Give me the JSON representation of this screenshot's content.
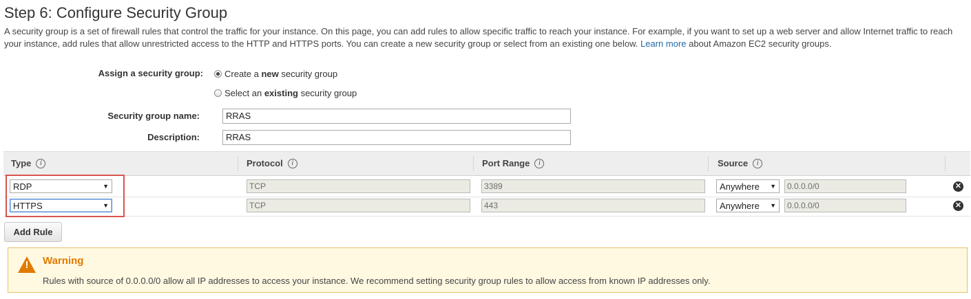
{
  "page": {
    "title": "Step 6: Configure Security Group",
    "intro_before_link": "A security group is a set of firewall rules that control the traffic for your instance. On this page, you can add rules to allow specific traffic to reach your instance. For example, if you want to set up a web server and allow Internet traffic to reach your instance, add rules that allow unrestricted access to the HTTP and HTTPS ports. You can create a new security group or select from an existing one below.",
    "intro_link": "Learn more",
    "intro_after_link": "about Amazon EC2 security groups."
  },
  "assign": {
    "label": "Assign a security group:",
    "options": [
      {
        "pre": "Create a ",
        "bold": "new",
        "post": " security group",
        "selected": true
      },
      {
        "pre": "Select an ",
        "bold": "existing",
        "post": " security group",
        "selected": false
      }
    ]
  },
  "form": {
    "name_label": "Security group name:",
    "name_value": "RRAS",
    "desc_label": "Description:",
    "desc_value": "RRAS"
  },
  "table": {
    "headers": [
      "Type",
      "Protocol",
      "Port Range",
      "Source"
    ],
    "info_glyph": "i",
    "rows": [
      {
        "type": "RDP",
        "protocol": "TCP",
        "port": "3389",
        "source": "Anywhere",
        "cidr": "0.0.0.0/0"
      },
      {
        "type": "HTTPS",
        "protocol": "TCP",
        "port": "443",
        "source": "Anywhere",
        "cidr": "0.0.0.0/0"
      }
    ],
    "delete_glyph": "✕"
  },
  "add_rule_label": "Add Rule",
  "warning": {
    "title": "Warning",
    "text": "Rules with source of 0.0.0.0/0 allow all IP addresses to access your instance. We recommend setting security group rules to allow access from known IP addresses only.",
    "icon_glyph": "!"
  },
  "colors": {
    "link": "#1f6aa8",
    "warning_title": "#e07b00",
    "warning_bg": "#fff9e2",
    "highlight": "#d9534f"
  }
}
